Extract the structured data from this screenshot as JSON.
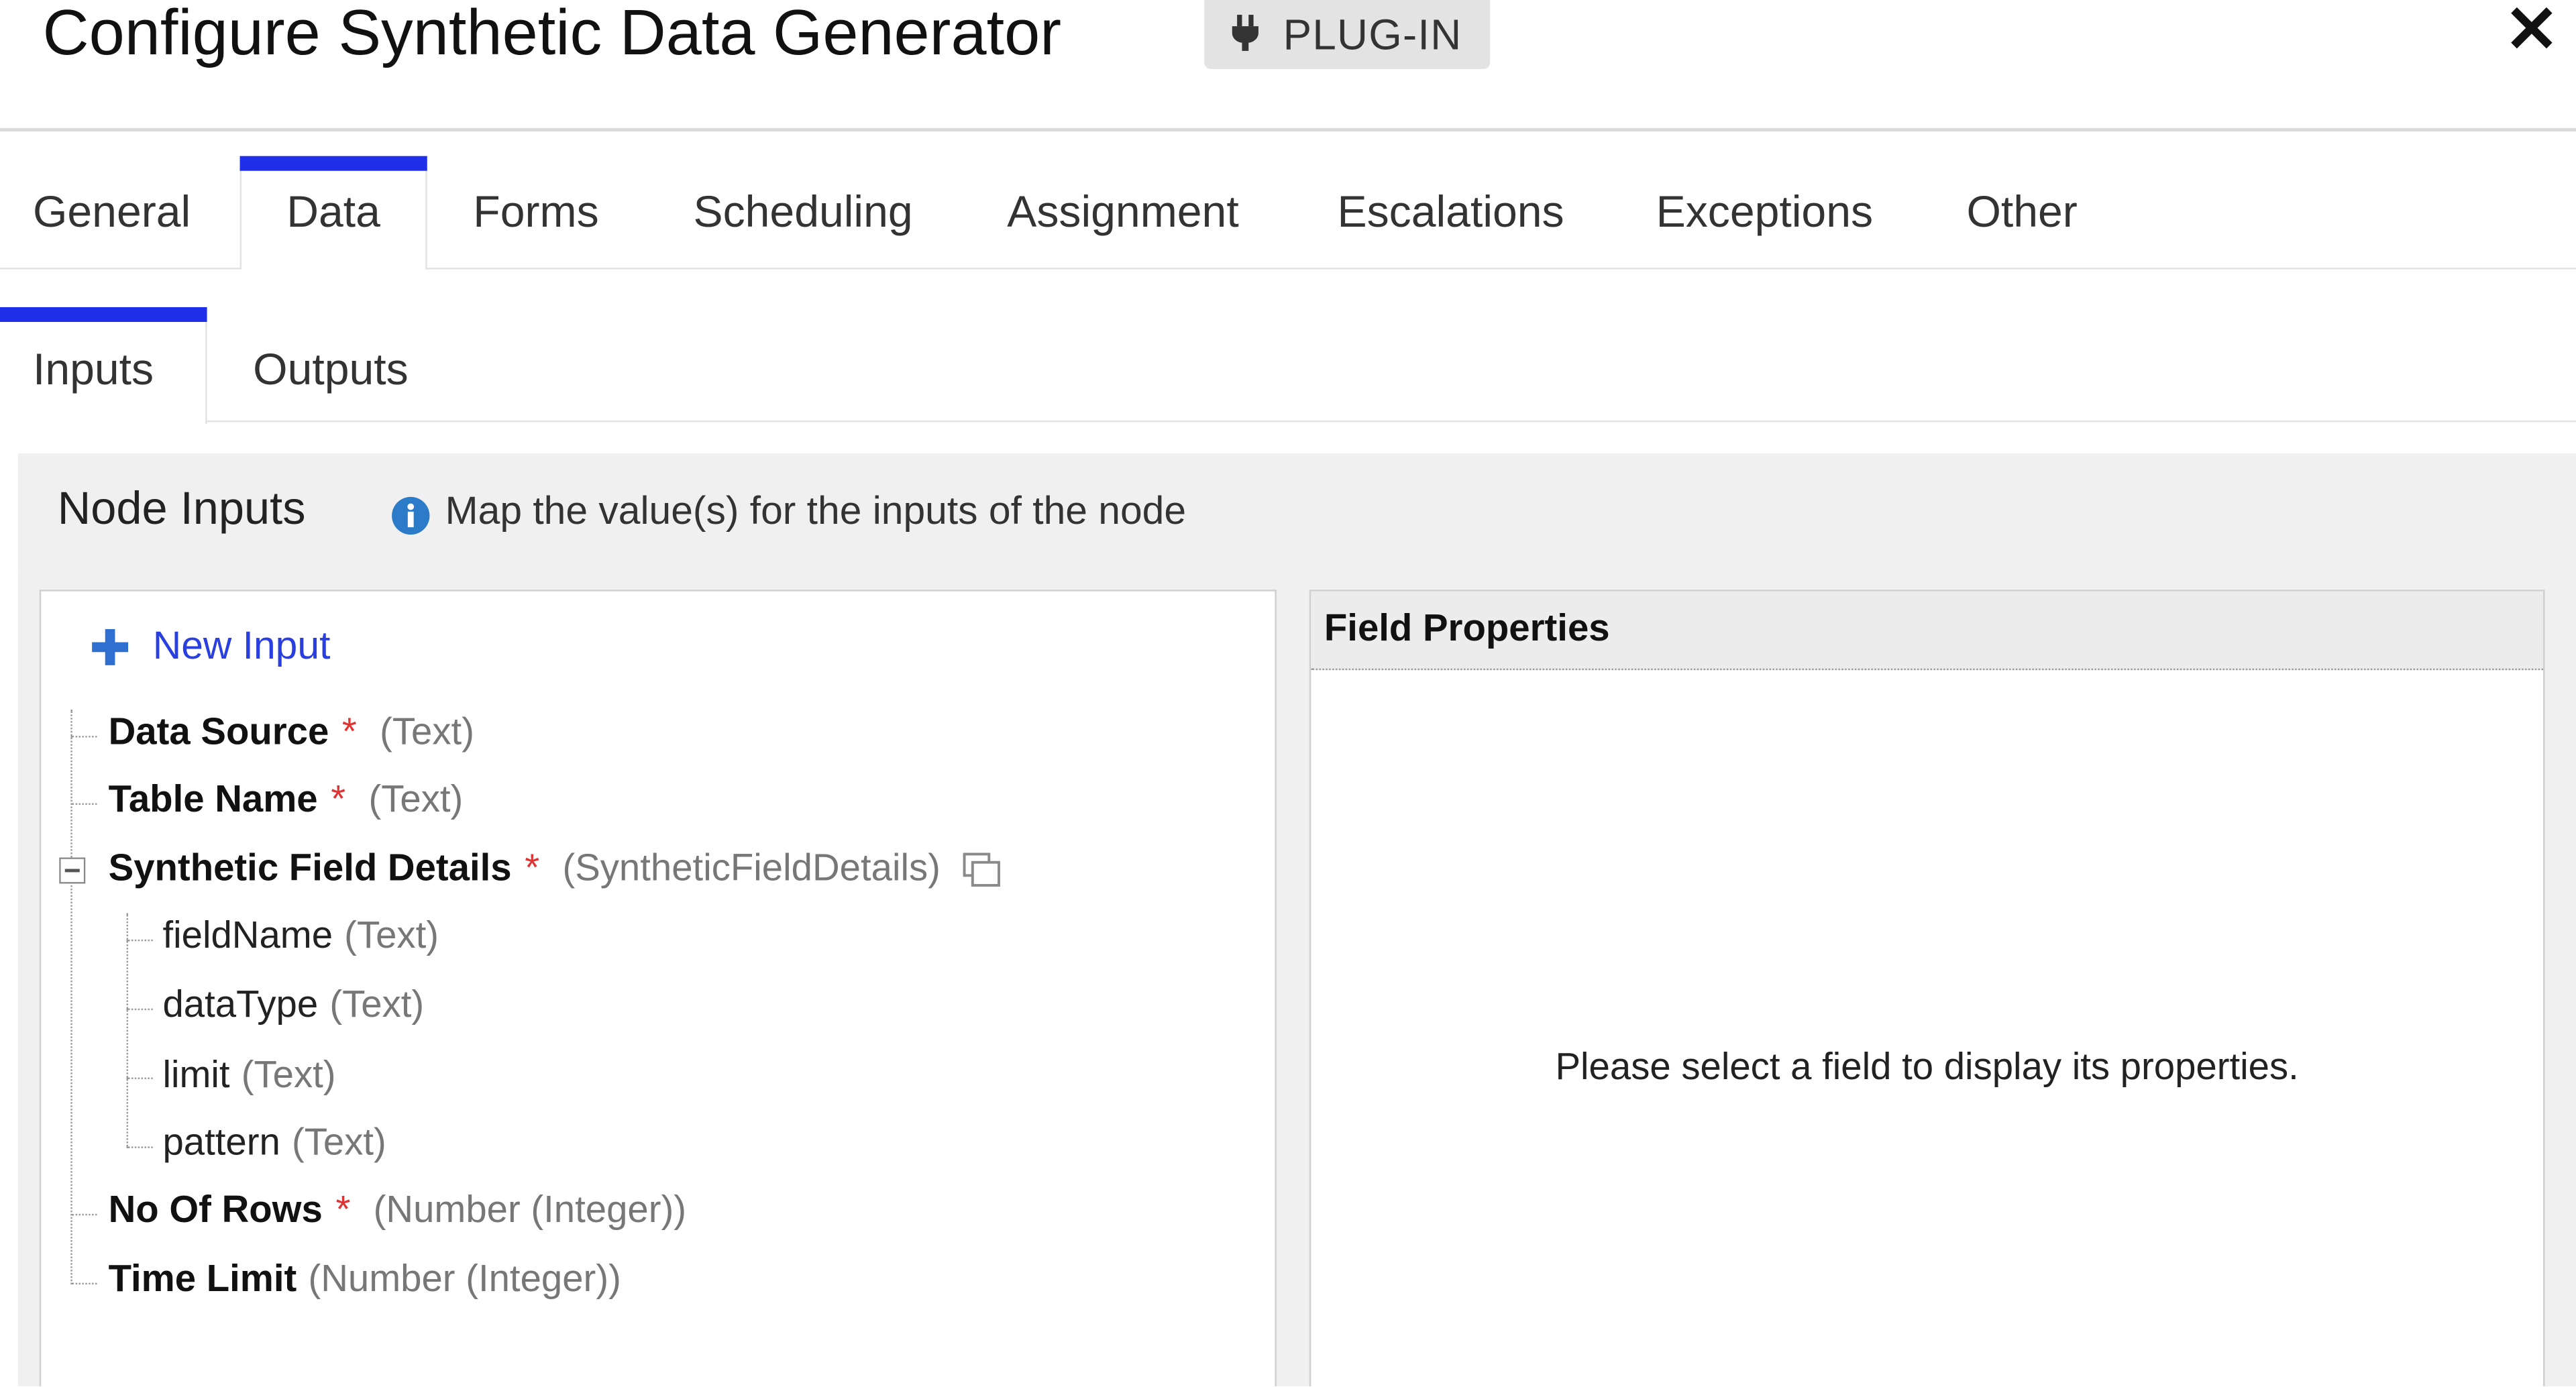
{
  "dialog": {
    "title": "Configure Synthetic Data Generator",
    "badge": {
      "icon": "plug-icon",
      "label": "PLUG-IN"
    },
    "close_icon": "close-icon"
  },
  "tabs": [
    {
      "label": "General",
      "active": false
    },
    {
      "label": "Data",
      "active": true
    },
    {
      "label": "Forms",
      "active": false
    },
    {
      "label": "Scheduling",
      "active": false
    },
    {
      "label": "Assignment",
      "active": false
    },
    {
      "label": "Escalations",
      "active": false
    },
    {
      "label": "Exceptions",
      "active": false
    },
    {
      "label": "Other",
      "active": false
    }
  ],
  "subtabs": [
    {
      "label": "Inputs",
      "active": true
    },
    {
      "label": "Outputs",
      "active": false
    }
  ],
  "node_inputs": {
    "title": "Node Inputs",
    "hint": "Map the value(s) for the inputs of the node",
    "info_icon": "info-icon"
  },
  "tree": {
    "new_input": {
      "icon": "plus-icon",
      "label": "New Input"
    },
    "rows": [
      {
        "name": "Data Source",
        "required": "*",
        "type": "(Text)"
      },
      {
        "name": "Table Name",
        "required": "*",
        "type": "(Text)"
      },
      {
        "name": "Synthetic Field Details",
        "required": "*",
        "type": "(SyntheticFieldDetails)",
        "expanded": true
      },
      {
        "name": "fieldName",
        "type": "(Text)",
        "child": true
      },
      {
        "name": "dataType",
        "type": "(Text)",
        "child": true
      },
      {
        "name": "limit",
        "type": "(Text)",
        "child": true
      },
      {
        "name": "pattern",
        "type": "(Text)",
        "child": true
      },
      {
        "name": "No Of Rows",
        "required": "*",
        "type": "(Number (Integer))"
      },
      {
        "name": "Time Limit",
        "type": "(Number (Integer))"
      }
    ]
  },
  "field_properties": {
    "title": "Field Properties",
    "empty_message": "Please select a field to display its properties."
  },
  "colors": {
    "accent": "#1f2ee8",
    "link": "#2a3fe0",
    "required": "#e03434",
    "info": "#2b7bc8",
    "plus": "#2f6fd0",
    "band": "#f0f0f0"
  }
}
